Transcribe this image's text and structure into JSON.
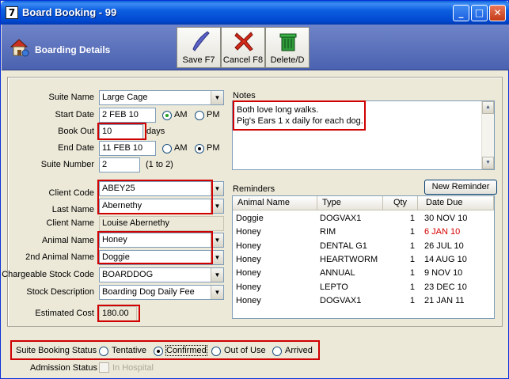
{
  "window": {
    "title": "Board Booking - 99",
    "app_icon_glyph": "7"
  },
  "header": {
    "section_title": "Boarding Details"
  },
  "toolbar": {
    "save_label": "Save F7",
    "cancel_label": "Cancel F8",
    "delete_label": "Delete/D"
  },
  "suite": {
    "name_label": "Suite Name",
    "name_value": "Large Cage",
    "start_label": "Start Date",
    "start_value": "2 FEB 10",
    "am": "AM",
    "pm": "PM",
    "bookout_label": "Book Out",
    "bookout_value": "10",
    "bookout_unit": "days",
    "end_label": "End Date",
    "end_value": "11 FEB 10",
    "number_label": "Suite Number",
    "number_value": "2",
    "number_hint": "(1 to 2)"
  },
  "notes": {
    "label": "Notes",
    "line1": "Both love long walks.",
    "line2": "Pig's Ears 1 x daily for each dog."
  },
  "client": {
    "code_label": "Client Code",
    "code_value": "ABEY25",
    "lastname_label": "Last Name",
    "lastname_value": "Abernethy",
    "name_label": "Client Name",
    "name_value": "Louise Abernethy",
    "animal_label": "Animal Name",
    "animal_value": "Honey",
    "animal2_label": "2nd Animal Name",
    "animal2_value": "Doggie",
    "stock_code_label": "Chargeable Stock Code",
    "stock_code_value": "BOARDDOG",
    "stock_desc_label": "Stock Description",
    "stock_desc_value": "Boarding Dog Daily Fee",
    "cost_label": "Estimated Cost",
    "cost_value": "180.00"
  },
  "reminders": {
    "label": "Reminders",
    "new_button": "New Reminder",
    "columns": [
      "Animal Name",
      "Type",
      "Qty",
      "Date Due"
    ],
    "rows": [
      {
        "animal": "Doggie",
        "type": "DOGVAX1",
        "qty": "1",
        "due": "30 NOV 10",
        "overdue": false
      },
      {
        "animal": "Honey",
        "type": "RIM",
        "qty": "1",
        "due": "6 JAN 10",
        "overdue": true
      },
      {
        "animal": "Honey",
        "type": "DENTAL G1",
        "qty": "1",
        "due": "26 JUL 10",
        "overdue": false
      },
      {
        "animal": "Honey",
        "type": "HEARTWORM",
        "qty": "1",
        "due": "14 AUG 10",
        "overdue": false
      },
      {
        "animal": "Honey",
        "type": "ANNUAL",
        "qty": "1",
        "due": "9 NOV 10",
        "overdue": false
      },
      {
        "animal": "Honey",
        "type": "LEPTO",
        "qty": "1",
        "due": "23 DEC 10",
        "overdue": false
      },
      {
        "animal": "Honey",
        "type": "DOGVAX1",
        "qty": "1",
        "due": "21 JAN 11",
        "overdue": false
      }
    ]
  },
  "status": {
    "label": "Suite Booking Status",
    "options": [
      "Tentative",
      "Confirmed",
      "Out of Use",
      "Arrived"
    ],
    "selected": "Confirmed",
    "admission_label": "Admission Status",
    "in_hospital": "In Hospital"
  },
  "colors": {
    "overdue": "#d40000",
    "highlight_box": "#d00000"
  }
}
